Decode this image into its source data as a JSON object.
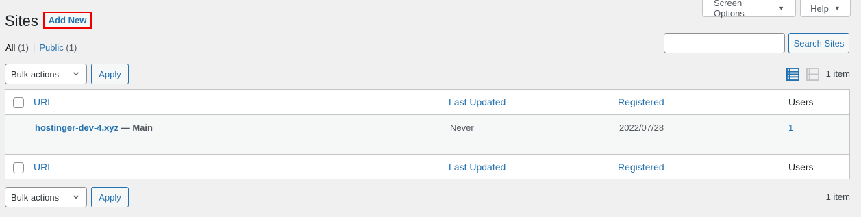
{
  "header": {
    "title": "Sites",
    "add_new": "Add New",
    "screen_options": "Screen Options",
    "help": "Help"
  },
  "filters": {
    "all_label": "All",
    "all_count": "(1)",
    "separator": "|",
    "public_label": "Public",
    "public_count": "(1)"
  },
  "search": {
    "input_value": "",
    "button_label": "Search Sites"
  },
  "tablenav_top": {
    "bulk_actions": "Bulk actions",
    "apply": "Apply",
    "items": "1 item"
  },
  "tablenav_bottom": {
    "bulk_actions": "Bulk actions",
    "apply": "Apply",
    "items": "1 item"
  },
  "table": {
    "columns": {
      "url": "URL",
      "last_updated": "Last Updated",
      "registered": "Registered",
      "users": "Users"
    },
    "rows": [
      {
        "url": "hostinger-dev-4.xyz",
        "suffix": " — Main",
        "last_updated": "Never",
        "registered": "2022/07/28",
        "users": "1"
      }
    ]
  },
  "colors": {
    "link": "#2271b1",
    "highlight_border": "#ee0000",
    "background": "#f0f0f1"
  },
  "icons": {
    "list_view": "list-view-icon",
    "excerpt_view": "excerpt-view-icon",
    "dropdown": "chevron-down-icon",
    "caret": "caret-down-icon"
  }
}
